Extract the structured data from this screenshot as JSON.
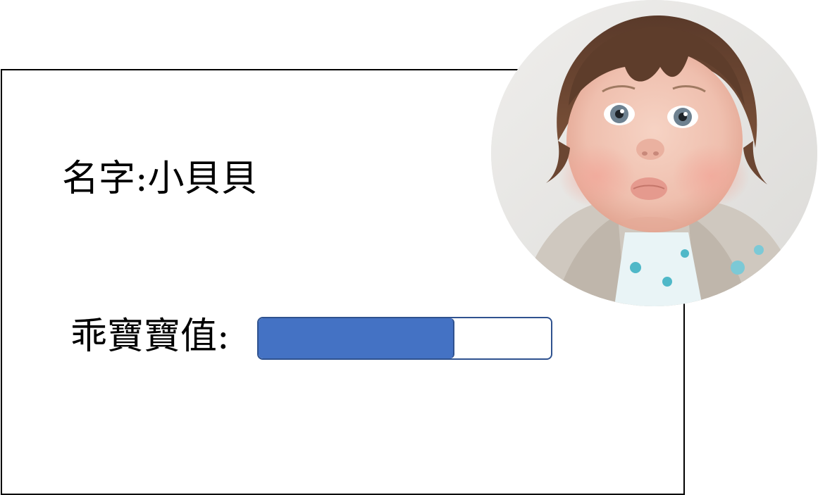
{
  "profile": {
    "name_text": "名字:小貝貝",
    "cuteness_label": "乖寶寶值:",
    "cuteness_level": 0.67
  },
  "colors": {
    "bar_fill": "#4472c4",
    "bar_border": "#2f528f",
    "card_border": "#000000"
  },
  "avatar": {
    "icon": "baby-photo"
  }
}
